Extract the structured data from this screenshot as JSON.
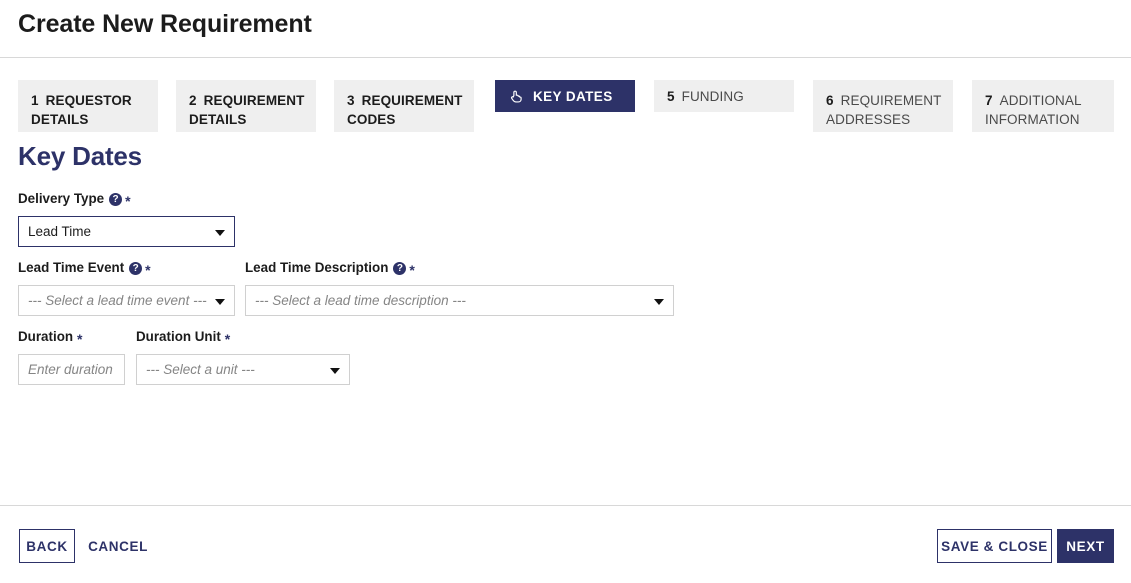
{
  "header": {
    "title": "Create New Requirement"
  },
  "stepper": {
    "tabs": [
      {
        "num": "1",
        "label": "REQUESTOR DETAILS",
        "state": "visited",
        "lines": 2,
        "icon": ""
      },
      {
        "num": "2",
        "label": "REQUIREMENT DETAILS",
        "state": "visited",
        "lines": 2,
        "icon": ""
      },
      {
        "num": "3",
        "label": "REQUIREMENT CODES",
        "state": "visited",
        "lines": 2,
        "icon": ""
      },
      {
        "num": "",
        "label": "KEY DATES",
        "state": "active",
        "lines": 1,
        "icon": "hand-point-up-icon"
      },
      {
        "num": "5",
        "label": "FUNDING",
        "state": "upcoming",
        "lines": 1,
        "icon": ""
      },
      {
        "num": "6",
        "label": "REQUIREMENT ADDRESSES",
        "state": "upcoming",
        "lines": 2,
        "icon": ""
      },
      {
        "num": "7",
        "label": "ADDITIONAL INFORMATION",
        "state": "upcoming",
        "lines": 2,
        "icon": ""
      }
    ]
  },
  "main": {
    "section_title": "Key Dates",
    "fields": {
      "delivery_type": {
        "label": "Delivery Type",
        "help": "?",
        "required": "*",
        "value": "Lead Time",
        "has_help": true
      },
      "lead_time_event": {
        "label": "Lead Time Event",
        "help": "?",
        "required": "*",
        "placeholder": "--- Select a lead time event ---",
        "has_help": true
      },
      "lead_time_description": {
        "label": "Lead Time Description",
        "help": "?",
        "required": "*",
        "placeholder": "--- Select a lead time description ---",
        "has_help": true
      },
      "duration": {
        "label": "Duration",
        "required": "*",
        "placeholder": "Enter duration",
        "has_help": false
      },
      "duration_unit": {
        "label": "Duration Unit",
        "required": "*",
        "placeholder": "--- Select a unit ---",
        "has_help": false
      }
    }
  },
  "footer": {
    "back_label": "BACK",
    "cancel_label": "CANCEL",
    "save_close_label": "SAVE & CLOSE",
    "next_label": "NEXT"
  },
  "colors": {
    "navy": "#2d3268",
    "tab_inactive_bg": "#efefef",
    "divider": "#d8d8d8",
    "placeholder_text": "#858585"
  }
}
